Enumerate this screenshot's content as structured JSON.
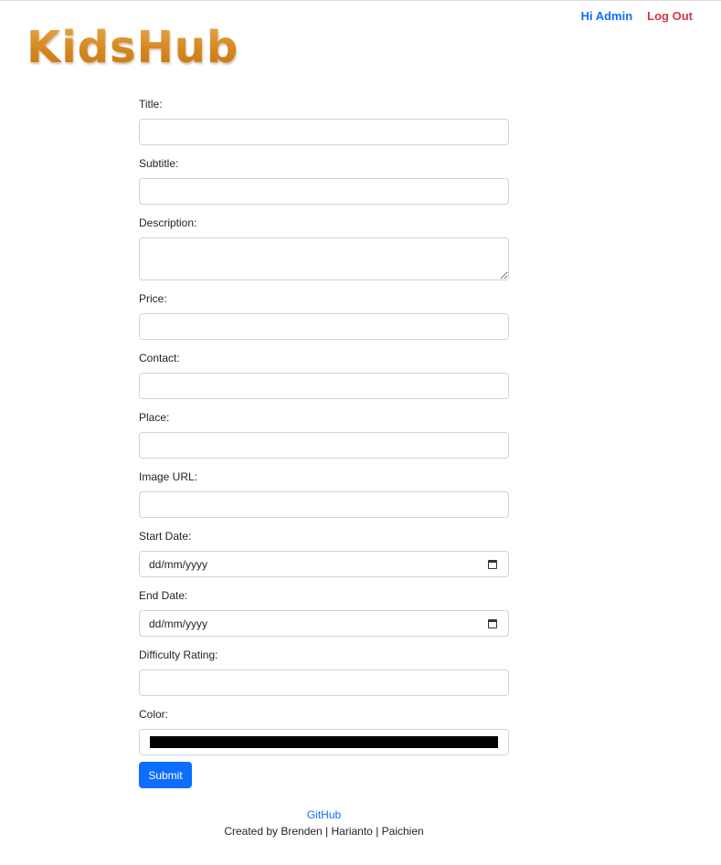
{
  "header": {
    "logo_text": "KidsHub",
    "user_greeting": "Hi Admin",
    "logout_label": "Log Out"
  },
  "form": {
    "fields": {
      "title": {
        "label": "Title:",
        "value": ""
      },
      "subtitle": {
        "label": "Subtitle:",
        "value": ""
      },
      "description": {
        "label": "Description:",
        "value": ""
      },
      "price": {
        "label": "Price:",
        "value": ""
      },
      "contact": {
        "label": "Contact:",
        "value": ""
      },
      "place": {
        "label": "Place:",
        "value": ""
      },
      "image_url": {
        "label": "Image URL:",
        "value": ""
      },
      "start_date": {
        "label": "Start Date:",
        "placeholder": "dd/mm/yyyy"
      },
      "end_date": {
        "label": "End Date:",
        "placeholder": "dd/mm/yyyy"
      },
      "difficulty_rating": {
        "label": "Difficulty Rating:",
        "value": ""
      },
      "color": {
        "label": "Color:",
        "value": "#000000"
      }
    },
    "submit_label": "Submit"
  },
  "footer": {
    "github_link": "GitHub",
    "credits": "Created by Brenden | Harianto | Paichien"
  },
  "colors": {
    "primary": "#0d6efd",
    "danger": "#dc3545",
    "logo": "#d98a2a"
  }
}
